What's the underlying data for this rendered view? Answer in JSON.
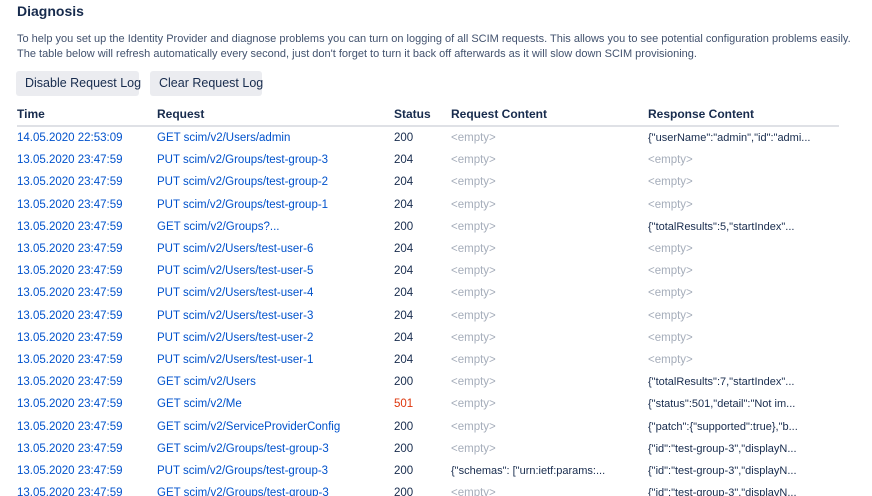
{
  "header": {
    "title": "Diagnosis",
    "description": "To help you set up the Identity Provider and diagnose problems you can turn on logging of all SCIM requests. This allows you to see potential configuration problems easily. The table below will refresh automatically every second, just don't forget to turn it back off afterwards as it will slow down SCIM provisioning."
  },
  "buttons": {
    "disable_label": "Disable Request Log",
    "clear_label": "Clear Request Log"
  },
  "table": {
    "columns": [
      "Time",
      "Request",
      "Status",
      "Request Content",
      "Response Content"
    ],
    "rows": [
      {
        "time": "14.05.2020 22:53:09",
        "request": "GET scim/v2/Users/admin",
        "status": "200",
        "request_content": "<empty>",
        "response_content": "{\"userName\":\"admin\",\"id\":\"admi..."
      },
      {
        "time": "13.05.2020 23:47:59",
        "request": "PUT scim/v2/Groups/test-group-3",
        "status": "204",
        "request_content": "<empty>",
        "response_content": "<empty>"
      },
      {
        "time": "13.05.2020 23:47:59",
        "request": "PUT scim/v2/Groups/test-group-2",
        "status": "204",
        "request_content": "<empty>",
        "response_content": "<empty>"
      },
      {
        "time": "13.05.2020 23:47:59",
        "request": "PUT scim/v2/Groups/test-group-1",
        "status": "204",
        "request_content": "<empty>",
        "response_content": "<empty>"
      },
      {
        "time": "13.05.2020 23:47:59",
        "request": "GET scim/v2/Groups?...",
        "status": "200",
        "request_content": "<empty>",
        "response_content": "{\"totalResults\":5,\"startIndex\"..."
      },
      {
        "time": "13.05.2020 23:47:59",
        "request": "PUT scim/v2/Users/test-user-6",
        "status": "204",
        "request_content": "<empty>",
        "response_content": "<empty>"
      },
      {
        "time": "13.05.2020 23:47:59",
        "request": "PUT scim/v2/Users/test-user-5",
        "status": "204",
        "request_content": "<empty>",
        "response_content": "<empty>"
      },
      {
        "time": "13.05.2020 23:47:59",
        "request": "PUT scim/v2/Users/test-user-4",
        "status": "204",
        "request_content": "<empty>",
        "response_content": "<empty>"
      },
      {
        "time": "13.05.2020 23:47:59",
        "request": "PUT scim/v2/Users/test-user-3",
        "status": "204",
        "request_content": "<empty>",
        "response_content": "<empty>"
      },
      {
        "time": "13.05.2020 23:47:59",
        "request": "PUT scim/v2/Users/test-user-2",
        "status": "204",
        "request_content": "<empty>",
        "response_content": "<empty>"
      },
      {
        "time": "13.05.2020 23:47:59",
        "request": "PUT scim/v2/Users/test-user-1",
        "status": "204",
        "request_content": "<empty>",
        "response_content": "<empty>"
      },
      {
        "time": "13.05.2020 23:47:59",
        "request": "GET scim/v2/Users",
        "status": "200",
        "request_content": "<empty>",
        "response_content": "{\"totalResults\":7,\"startIndex\"..."
      },
      {
        "time": "13.05.2020 23:47:59",
        "request": "GET scim/v2/Me",
        "status": "501",
        "request_content": "<empty>",
        "response_content": "{\"status\":501,\"detail\":\"Not im..."
      },
      {
        "time": "13.05.2020 23:47:59",
        "request": "GET scim/v2/ServiceProviderConfig",
        "status": "200",
        "request_content": "<empty>",
        "response_content": "{\"patch\":{\"supported\":true},\"b..."
      },
      {
        "time": "13.05.2020 23:47:59",
        "request": "GET scim/v2/Groups/test-group-3",
        "status": "200",
        "request_content": "<empty>",
        "response_content": "{\"id\":\"test-group-3\",\"displayN..."
      },
      {
        "time": "13.05.2020 23:47:59",
        "request": "PUT scim/v2/Groups/test-group-3",
        "status": "200",
        "request_content": "{\"schemas\": [\"urn:ietf:params:...",
        "response_content": "{\"id\":\"test-group-3\",\"displayN..."
      },
      {
        "time": "13.05.2020 23:47:59",
        "request": "GET scim/v2/Groups/test-group-3",
        "status": "200",
        "request_content": "<empty>",
        "response_content": "{\"id\":\"test-group-3\",\"displayN..."
      }
    ]
  },
  "colors": {
    "link": "#0052cc",
    "error": "#de350b",
    "muted": "#a5adba",
    "button_bg": "#ebecf0"
  }
}
